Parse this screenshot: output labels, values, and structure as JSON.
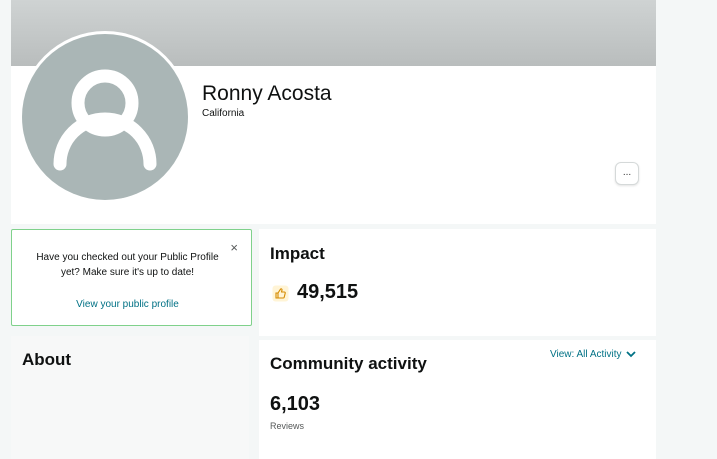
{
  "profile": {
    "name": "Ronny Acosta",
    "location": "California",
    "more_label": "..."
  },
  "prompt": {
    "close_glyph": "×",
    "message": "Have you checked out your Public Profile yet? Make sure it's up to date!",
    "link_label": "View your public profile"
  },
  "impact": {
    "title": "Impact",
    "value": "49,515",
    "icon": "thumbs-up-icon"
  },
  "about": {
    "title": "About"
  },
  "community": {
    "title": "Community activity",
    "view_label": "View:",
    "view_value": "All Activity",
    "reviews_count": "6,103",
    "reviews_label": "Reviews"
  },
  "colors": {
    "link": "#007185",
    "prompt_border": "#7fd18b",
    "avatar_bg": "#aab6b6",
    "impact_icon": "#f0a500"
  }
}
